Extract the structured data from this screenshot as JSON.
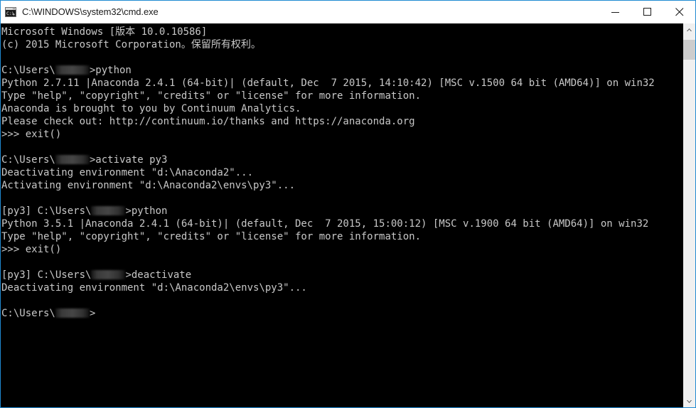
{
  "window": {
    "title": "C:\\WINDOWS\\system32\\cmd.exe",
    "icon": "cmd-console-icon",
    "border_color": "#1f8ad2",
    "titlebar_bg": "#ffffff",
    "titlebar_fg": "#1a1a1a",
    "console_bg": "#000000",
    "console_fg": "#c8c8c8"
  },
  "controls": {
    "minimize_label": "Minimize",
    "maximize_label": "Maximize",
    "close_label": "Close"
  },
  "scrollbar": {
    "up_arrow_label": "Scroll up",
    "down_arrow_label": "Scroll down",
    "thumb_label": "Scroll thumb",
    "track_color": "#f0f0f0",
    "thumb_color": "#cdcdcd"
  },
  "console": {
    "prompt_user_redacted": true,
    "lines": [
      {
        "id": "l01",
        "pre": "Microsoft Windows [版本 10.0.10586]"
      },
      {
        "id": "l02",
        "pre": "(c) 2015 Microsoft Corporation。保留所有权利。"
      },
      {
        "id": "l03",
        "pre": ""
      },
      {
        "id": "l04",
        "pre": "C:\\Users\\",
        "redact": true,
        "post": ">python"
      },
      {
        "id": "l05",
        "pre": "Python 2.7.11 |Anaconda 2.4.1 (64-bit)| (default, Dec  7 2015, 14:10:42) [MSC v.1500 64 bit (AMD64)] on win32"
      },
      {
        "id": "l06",
        "pre": "Type \"help\", \"copyright\", \"credits\" or \"license\" for more information."
      },
      {
        "id": "l07",
        "pre": "Anaconda is brought to you by Continuum Analytics."
      },
      {
        "id": "l08",
        "pre": "Please check out: http://continuum.io/thanks and https://anaconda.org"
      },
      {
        "id": "l09",
        "pre": ">>> exit()"
      },
      {
        "id": "l10",
        "pre": ""
      },
      {
        "id": "l11",
        "pre": "C:\\Users\\",
        "redact": true,
        "post": ">activate py3"
      },
      {
        "id": "l12",
        "pre": "Deactivating environment \"d:\\Anaconda2\"..."
      },
      {
        "id": "l13",
        "pre": "Activating environment \"d:\\Anaconda2\\envs\\py3\"..."
      },
      {
        "id": "l14",
        "pre": ""
      },
      {
        "id": "l15",
        "pre": "[py3] C:\\Users\\",
        "redact": true,
        "post": ">python"
      },
      {
        "id": "l16",
        "pre": "Python 3.5.1 |Anaconda 2.4.1 (64-bit)| (default, Dec  7 2015, 15:00:12) [MSC v.1900 64 bit (AMD64)] on win32"
      },
      {
        "id": "l17",
        "pre": "Type \"help\", \"copyright\", \"credits\" or \"license\" for more information."
      },
      {
        "id": "l18",
        "pre": ">>> exit()"
      },
      {
        "id": "l19",
        "pre": ""
      },
      {
        "id": "l20",
        "pre": "[py3] C:\\Users\\",
        "redact": true,
        "post": ">deactivate"
      },
      {
        "id": "l21",
        "pre": "Deactivating environment \"d:\\Anaconda2\\envs\\py3\"..."
      },
      {
        "id": "l22",
        "pre": ""
      },
      {
        "id": "l23",
        "pre": "C:\\Users\\",
        "redact": true,
        "post": ">"
      }
    ]
  }
}
